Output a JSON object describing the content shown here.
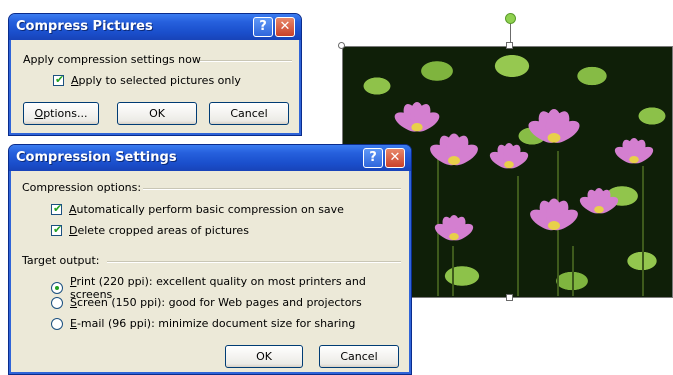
{
  "compress_dialog": {
    "title": "Compress Pictures",
    "help_label": "?",
    "close_label": "✕",
    "group_label": "Apply compression settings now",
    "apply_selected_prefix": "",
    "apply_selected_underlined": "A",
    "apply_selected_rest": "pply to selected pictures only",
    "apply_selected_checked": true,
    "options_button_prefix": "",
    "options_button_underlined": "O",
    "options_button_rest": "ptions...",
    "ok_label": "OK",
    "cancel_label": "Cancel"
  },
  "settings_dialog": {
    "title": "Compression Settings",
    "help_label": "?",
    "close_label": "✕",
    "options_group_label": "Compression options:",
    "auto_compress_underlined": "A",
    "auto_compress_rest": "utomatically perform basic compression on save",
    "auto_compress_checked": true,
    "delete_cropped_underlined": "D",
    "delete_cropped_rest": "elete cropped areas of pictures",
    "delete_cropped_checked": true,
    "target_group_label": "Target output:",
    "print_underlined": "P",
    "print_rest": "rint (220 ppi): excellent quality on most printers and screens",
    "screen_underlined": "S",
    "screen_rest": "creen (150 ppi): good for Web pages and projectors",
    "email_underlined": "E",
    "email_rest": "-mail (96 ppi): minimize document size for sharing",
    "selected_target": "print",
    "ok_label": "OK",
    "cancel_label": "Cancel"
  },
  "colors": {
    "titlebar": "#2660dd",
    "dialog_face": "#ece9d8",
    "check_mark": "#21a121",
    "rotation_handle": "#8fd14f"
  }
}
